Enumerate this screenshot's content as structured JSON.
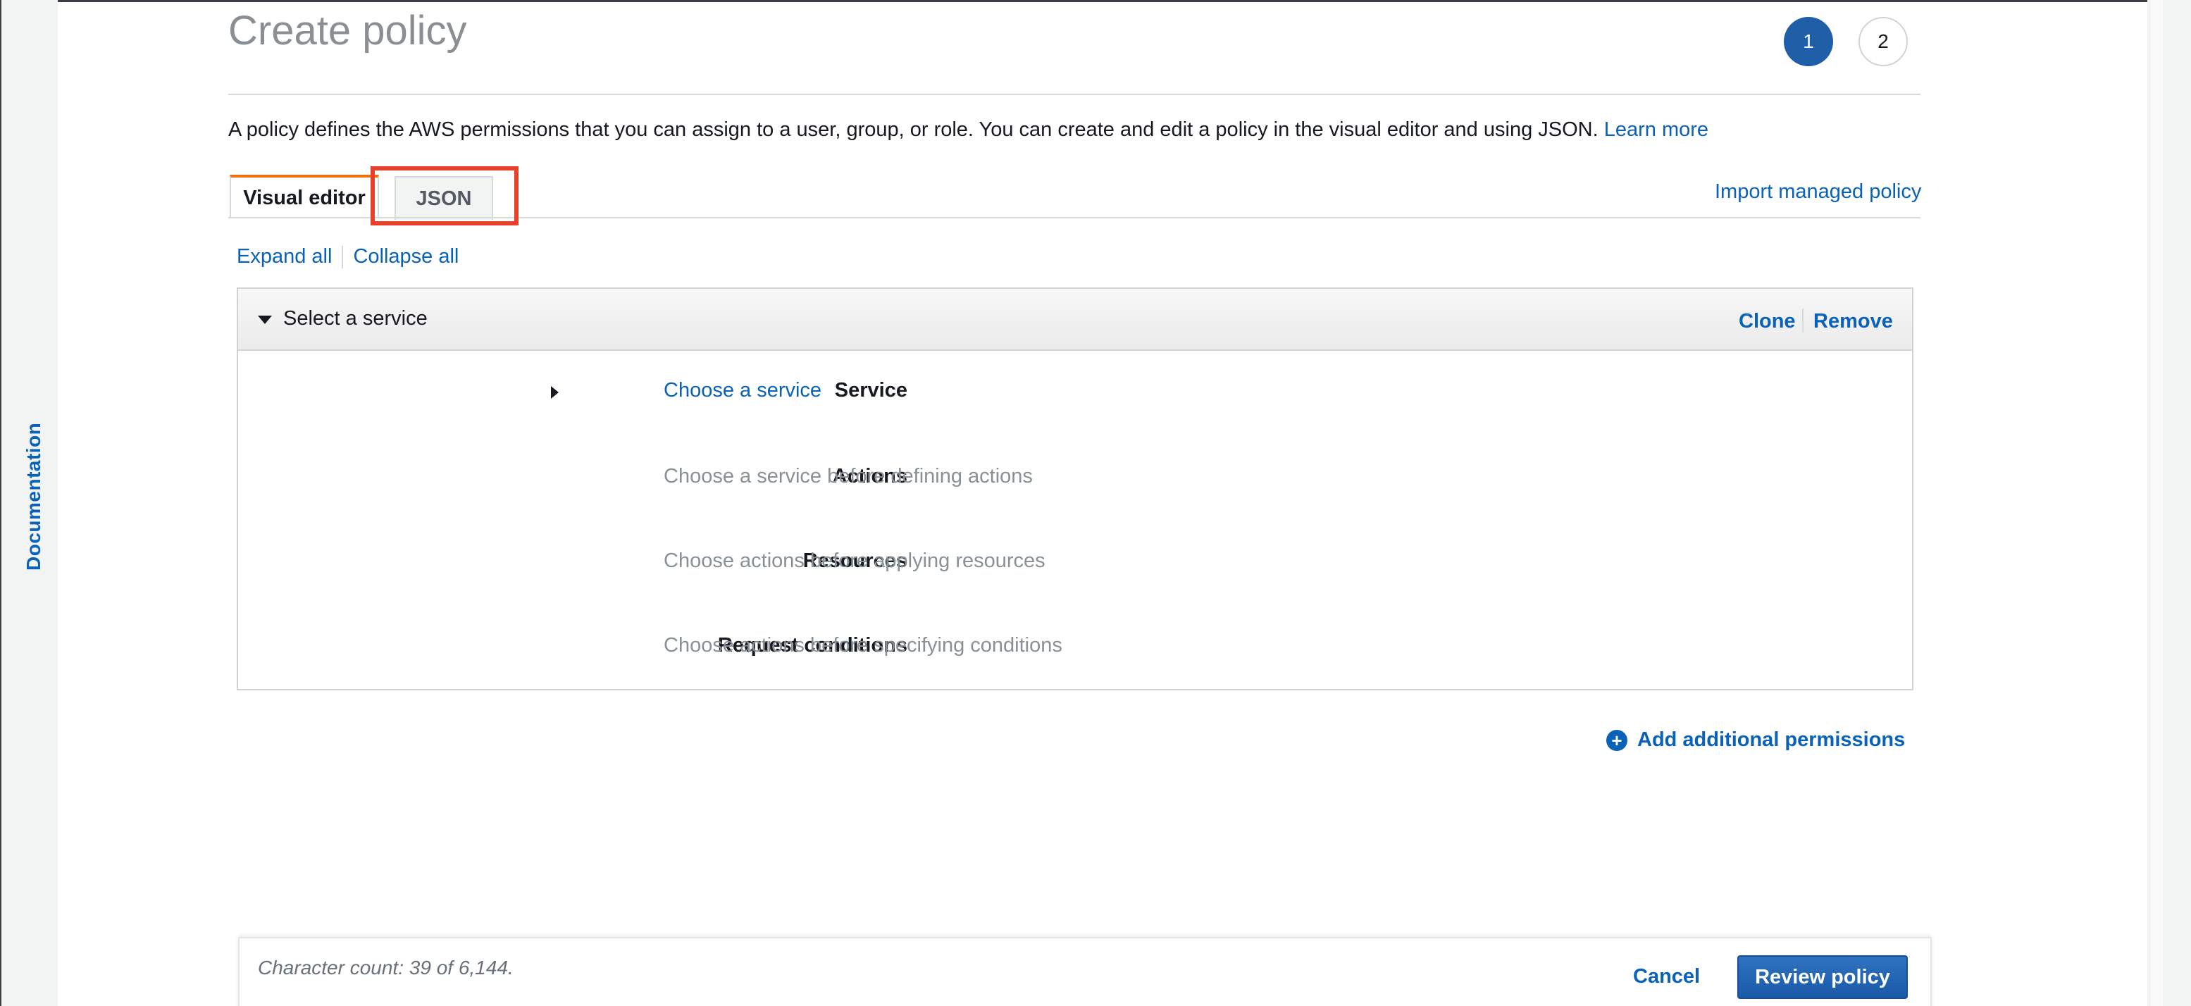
{
  "sidebar": {
    "documentation_label": "Documentation"
  },
  "page": {
    "title": "Create policy",
    "steps": [
      "1",
      "2"
    ],
    "description": "A policy defines the AWS permissions that you can assign to a user, group, or role. You can create and edit a policy in the visual editor and using JSON.",
    "learn_more": "Learn more"
  },
  "tabs": {
    "visual_editor": "Visual editor",
    "json": "JSON"
  },
  "import_managed_policy": "Import managed policy",
  "expand_all": "Expand all",
  "collapse_all": "Collapse all",
  "service_panel": {
    "title": "Select a service",
    "clone": "Clone",
    "remove": "Remove",
    "rows": [
      {
        "label": "Service",
        "value": "Choose a service"
      },
      {
        "label": "Actions",
        "value": "Choose a service before defining actions"
      },
      {
        "label": "Resources",
        "value": "Choose actions before applying resources"
      },
      {
        "label": "Request conditions",
        "value": "Choose actions before specifying conditions"
      }
    ]
  },
  "add_permissions": "Add additional permissions",
  "footer": {
    "character_count": "Character count: 39 of 6,144.",
    "cancel": "Cancel",
    "review_policy": "Review policy"
  },
  "colors": {
    "link": "#0a62b8",
    "primary_button": "#1a59a8",
    "active_tab_accent": "#ec7211",
    "highlight_box": "#e8402a"
  }
}
